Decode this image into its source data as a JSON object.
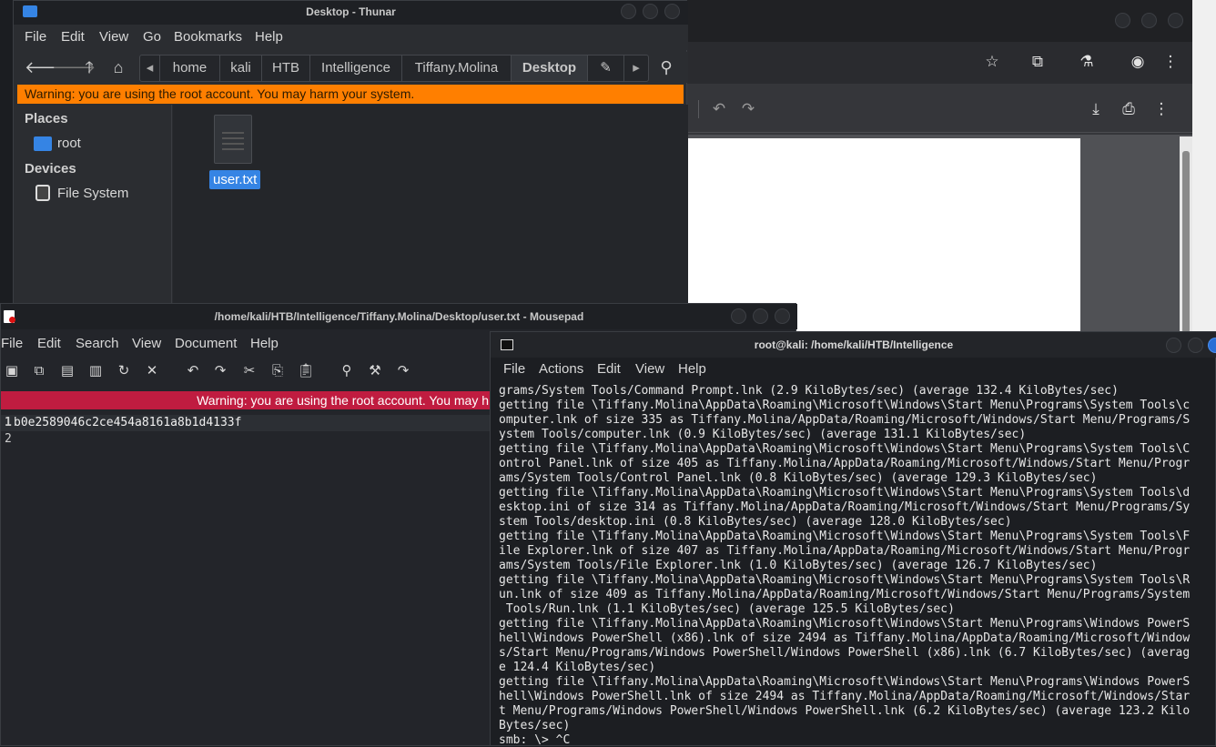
{
  "thunar": {
    "title": "Desktop - Thunar",
    "menu": [
      "File",
      "Edit",
      "View",
      "Go",
      "Bookmarks",
      "Help"
    ],
    "breadcrumbs": [
      "home",
      "kali",
      "HTB",
      "Intelligence",
      "Tiffany.Molina",
      "Desktop"
    ],
    "warning": "Warning: you are using the root account. You may harm your system.",
    "places_heading": "Places",
    "places": [
      "root"
    ],
    "devices_heading": "Devices",
    "devices": [
      "File System"
    ],
    "file": "user.txt"
  },
  "mousepad": {
    "title": "/home/kali/HTB/Intelligence/Tiffany.Molina/Desktop/user.txt - Mousepad",
    "menu": [
      "File",
      "Edit",
      "Search",
      "View",
      "Document",
      "Help"
    ],
    "warning": "Warning: you are using the root account. You may h",
    "lines": [
      {
        "num": "1",
        "text": "b0e2589046c2ce454a8161a8b1d4133f"
      },
      {
        "num": "2",
        "text": ""
      }
    ]
  },
  "terminal": {
    "title": "root@kali: /home/kali/HTB/Intelligence",
    "menu": [
      "File",
      "Actions",
      "Edit",
      "View",
      "Help"
    ],
    "output": "grams/System Tools/Command Prompt.lnk (2.9 KiloBytes/sec) (average 132.4 KiloBytes/sec)\ngetting file \\Tiffany.Molina\\AppData\\Roaming\\Microsoft\\Windows\\Start Menu\\Programs\\System Tools\\c\nomputer.lnk of size 335 as Tiffany.Molina/AppData/Roaming/Microsoft/Windows/Start Menu/Programs/S\nystem Tools/computer.lnk (0.9 KiloBytes/sec) (average 131.1 KiloBytes/sec)\ngetting file \\Tiffany.Molina\\AppData\\Roaming\\Microsoft\\Windows\\Start Menu\\Programs\\System Tools\\C\nontrol Panel.lnk of size 405 as Tiffany.Molina/AppData/Roaming/Microsoft/Windows/Start Menu/Progr\nams/System Tools/Control Panel.lnk (0.8 KiloBytes/sec) (average 129.3 KiloBytes/sec)\ngetting file \\Tiffany.Molina\\AppData\\Roaming\\Microsoft\\Windows\\Start Menu\\Programs\\System Tools\\d\nesktop.ini of size 314 as Tiffany.Molina/AppData/Roaming/Microsoft/Windows/Start Menu/Programs/Sy\nstem Tools/desktop.ini (0.8 KiloBytes/sec) (average 128.0 KiloBytes/sec)\ngetting file \\Tiffany.Molina\\AppData\\Roaming\\Microsoft\\Windows\\Start Menu\\Programs\\System Tools\\F\nile Explorer.lnk of size 407 as Tiffany.Molina/AppData/Roaming/Microsoft/Windows/Start Menu/Progr\nams/System Tools/File Explorer.lnk (1.0 KiloBytes/sec) (average 126.7 KiloBytes/sec)\ngetting file \\Tiffany.Molina\\AppData\\Roaming\\Microsoft\\Windows\\Start Menu\\Programs\\System Tools\\R\nun.lnk of size 409 as Tiffany.Molina/AppData/Roaming/Microsoft/Windows/Start Menu/Programs/System\n Tools/Run.lnk (1.1 KiloBytes/sec) (average 125.5 KiloBytes/sec)\ngetting file \\Tiffany.Molina\\AppData\\Roaming\\Microsoft\\Windows\\Start Menu\\Programs\\Windows PowerS\nhell\\Windows PowerShell (x86).lnk of size 2494 as Tiffany.Molina/AppData/Roaming/Microsoft/Window\ns/Start Menu/Programs/Windows PowerShell/Windows PowerShell (x86).lnk (6.7 KiloBytes/sec) (averag\ne 124.4 KiloBytes/sec)\ngetting file \\Tiffany.Molina\\AppData\\Roaming\\Microsoft\\Windows\\Start Menu\\Programs\\Windows PowerS\nhell\\Windows PowerShell.lnk of size 2494 as Tiffany.Molina/AppData/Roaming/Microsoft/Windows/Star\nt Menu/Programs/Windows PowerShell/Windows PowerShell.lnk (6.2 KiloBytes/sec) (average 123.2 Kilo\nBytes/sec)\nsmb: \\> ^C"
  },
  "icons": {
    "back": "arrow-left-icon",
    "forward": "arrow-right-icon",
    "up": "arrow-up-icon",
    "home": "home-icon",
    "search": "search-icon"
  },
  "colors": {
    "warning_orange": "#ff7f00",
    "warning_red": "#c01c40",
    "selection": "#3584e4"
  }
}
